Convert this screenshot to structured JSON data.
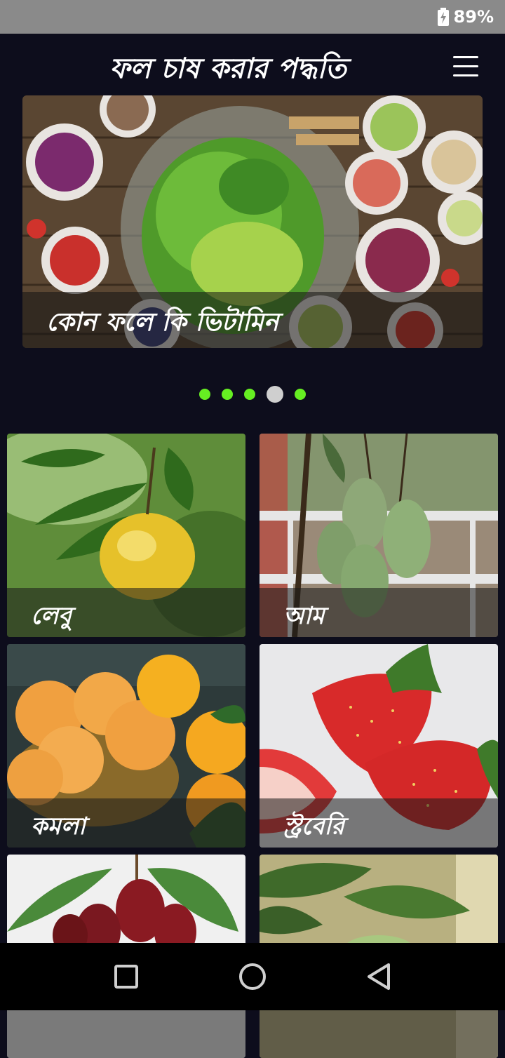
{
  "status_bar": {
    "battery_percent": "89%",
    "battery_icon": "battery-charging-icon"
  },
  "app_bar": {
    "title": "ফল চাষ করার পদ্ধতি",
    "menu_icon": "hamburger-menu-icon"
  },
  "carousel": {
    "caption": "কোন ফলে কি ভিটামিন",
    "slide_count": 5,
    "active_index": 3,
    "dot_color": "#66ee22",
    "active_dot_color": "#cfcfcf"
  },
  "fruits": [
    {
      "name": "লেবু"
    },
    {
      "name": "আম"
    },
    {
      "name": "কমলা"
    },
    {
      "name": "স্ট্রবেরি"
    },
    {
      "name": ""
    },
    {
      "name": ""
    }
  ],
  "nav_bar": {
    "recent_icon": "recent-apps-icon",
    "home_icon": "home-icon",
    "back_icon": "back-icon"
  }
}
